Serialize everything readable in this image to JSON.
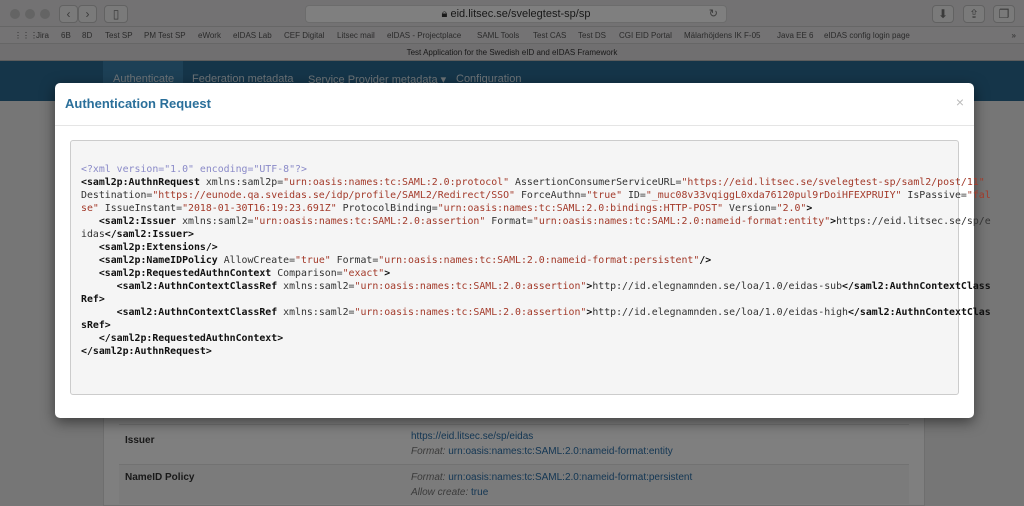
{
  "browser": {
    "url": "eid.litsec.se/svelegtest-sp/sp",
    "tab_title": "Test Application for the Swedish eID and eIDAS Framework",
    "bookmarks": [
      "Jira",
      "6B",
      "8D",
      "Test SP",
      "PM Test SP",
      "eWork",
      "eIDAS Lab",
      "CEF Digital",
      "Litsec mail",
      "eIDAS - Projectplace",
      "SAML Tools",
      "Test CAS",
      "Test DS",
      "CGI EID Portal",
      "Mälarhöjdens IK F-05",
      "Java EE 6",
      "eIDAS config login page"
    ]
  },
  "nav": {
    "items": [
      "Authenticate",
      "Federation metadata",
      "Service Provider metadata ▾",
      "Configuration"
    ],
    "active": 0
  },
  "page": {
    "rows": [
      {
        "key": "Issuer",
        "lines": [
          {
            "label": "",
            "value": "https://eid.litsec.se/sp/eidas"
          },
          {
            "label": "Format: ",
            "value": "urn:oasis:names:tc:SAML:2.0:nameid-format:entity"
          }
        ]
      },
      {
        "key": "NameID Policy",
        "lines": [
          {
            "label": "Format: ",
            "value": "urn:oasis:names:tc:SAML:2.0:nameid-format:persistent"
          },
          {
            "label": "Allow create: ",
            "value": "true"
          }
        ]
      }
    ]
  },
  "modal": {
    "title": "Authentication Request",
    "close": "×",
    "xml_lines": [
      [
        [
          "pi",
          "<?xml version=\"1.0\" encoding=\"UTF-8\"?>"
        ]
      ],
      [
        [
          "tag",
          "<saml2p:AuthnRequest"
        ],
        [
          "attr",
          " xmlns:saml2p="
        ],
        [
          "val",
          "\"urn:oasis:names:tc:SAML:2.0:protocol\""
        ],
        [
          "attr",
          " AssertionConsumerServiceURL="
        ],
        [
          "val",
          "\"https://eid.litsec.se/svelegtest-sp/saml2/post/11\""
        ]
      ],
      [
        [
          "attr",
          "Destination="
        ],
        [
          "val",
          "\"https://eunode.qa.sveidas.se/idp/profile/SAML2/Redirect/SSO\""
        ],
        [
          "attr",
          " ForceAuthn="
        ],
        [
          "val",
          "\"true\""
        ],
        [
          "attr",
          " ID="
        ],
        [
          "val",
          "\"_muc08v33vqiggL0xda76120pul9rDoiHFEXPRUIY\""
        ],
        [
          "attr",
          " IsPassive="
        ],
        [
          "val",
          "\"fal"
        ]
      ],
      [
        [
          "val",
          "se\""
        ],
        [
          "attr",
          " IssueInstant="
        ],
        [
          "val",
          "\"2018-01-30T16:19:23.691Z\""
        ],
        [
          "attr",
          " ProtocolBinding="
        ],
        [
          "val",
          "\"urn:oasis:names:tc:SAML:2.0:bindings:HTTP-POST\""
        ],
        [
          "attr",
          " Version="
        ],
        [
          "val",
          "\"2.0\""
        ],
        [
          "tag",
          ">"
        ]
      ],
      [
        [
          "attr",
          "   "
        ],
        [
          "tag",
          "<saml2:Issuer"
        ],
        [
          "attr",
          " xmlns:saml2="
        ],
        [
          "val",
          "\"urn:oasis:names:tc:SAML:2.0:assertion\""
        ],
        [
          "attr",
          " Format="
        ],
        [
          "val",
          "\"urn:oasis:names:tc:SAML:2.0:nameid-format:entity\""
        ],
        [
          "tag",
          ">"
        ],
        [
          "attr",
          "https://eid.litsec.se/sp/e"
        ]
      ],
      [
        [
          "attr",
          "idas"
        ],
        [
          "tag",
          "</saml2:Issuer>"
        ]
      ],
      [
        [
          "attr",
          "   "
        ],
        [
          "tag",
          "<saml2p:Extensions/>"
        ]
      ],
      [
        [
          "attr",
          "   "
        ],
        [
          "tag",
          "<saml2p:NameIDPolicy"
        ],
        [
          "attr",
          " AllowCreate="
        ],
        [
          "val",
          "\"true\""
        ],
        [
          "attr",
          " Format="
        ],
        [
          "val",
          "\"urn:oasis:names:tc:SAML:2.0:nameid-format:persistent\""
        ],
        [
          "tag",
          "/>"
        ]
      ],
      [
        [
          "attr",
          "   "
        ],
        [
          "tag",
          "<saml2p:RequestedAuthnContext"
        ],
        [
          "attr",
          " Comparison="
        ],
        [
          "val",
          "\"exact\""
        ],
        [
          "tag",
          ">"
        ]
      ],
      [
        [
          "attr",
          "      "
        ],
        [
          "tag",
          "<saml2:AuthnContextClassRef"
        ],
        [
          "attr",
          " xmlns:saml2="
        ],
        [
          "val",
          "\"urn:oasis:names:tc:SAML:2.0:assertion\""
        ],
        [
          "tag",
          ">"
        ],
        [
          "attr",
          "http://id.elegnamnden.se/loa/1.0/eidas-sub"
        ],
        [
          "tag",
          "</saml2:AuthnContextClass"
        ]
      ],
      [
        [
          "tag",
          "Ref>"
        ]
      ],
      [
        [
          "attr",
          "      "
        ],
        [
          "tag",
          "<saml2:AuthnContextClassRef"
        ],
        [
          "attr",
          " xmlns:saml2="
        ],
        [
          "val",
          "\"urn:oasis:names:tc:SAML:2.0:assertion\""
        ],
        [
          "tag",
          ">"
        ],
        [
          "attr",
          "http://id.elegnamnden.se/loa/1.0/eidas-high"
        ],
        [
          "tag",
          "</saml2:AuthnContextClas"
        ]
      ],
      [
        [
          "tag",
          "sRef>"
        ]
      ],
      [
        [
          "attr",
          "   "
        ],
        [
          "tag",
          "</saml2p:RequestedAuthnContext>"
        ]
      ],
      [
        [
          "tag",
          "</saml2p:AuthnRequest>"
        ]
      ]
    ]
  }
}
